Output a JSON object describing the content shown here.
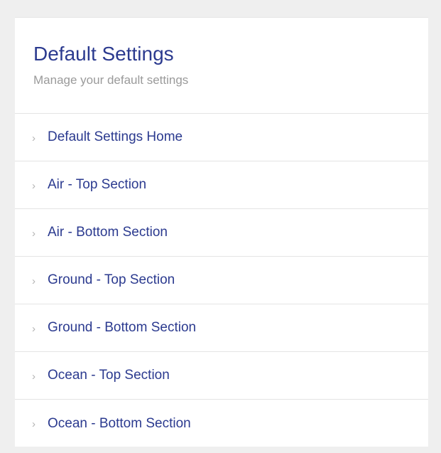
{
  "header": {
    "title": "Default Settings",
    "subtitle": "Manage your default settings"
  },
  "nav": {
    "chevron_icon": "chevron-right-icon",
    "items": [
      {
        "label": "Default Settings Home"
      },
      {
        "label": "Air - Top Section"
      },
      {
        "label": "Air - Bottom Section"
      },
      {
        "label": "Ground - Top Section"
      },
      {
        "label": "Ground - Bottom Section"
      },
      {
        "label": "Ocean - Top Section"
      },
      {
        "label": "Ocean - Bottom Section"
      }
    ]
  },
  "colors": {
    "accent": "#2b3a8f",
    "subtitle": "#9a9a9a",
    "background": "#efefef",
    "divider": "#e4e4e4"
  }
}
